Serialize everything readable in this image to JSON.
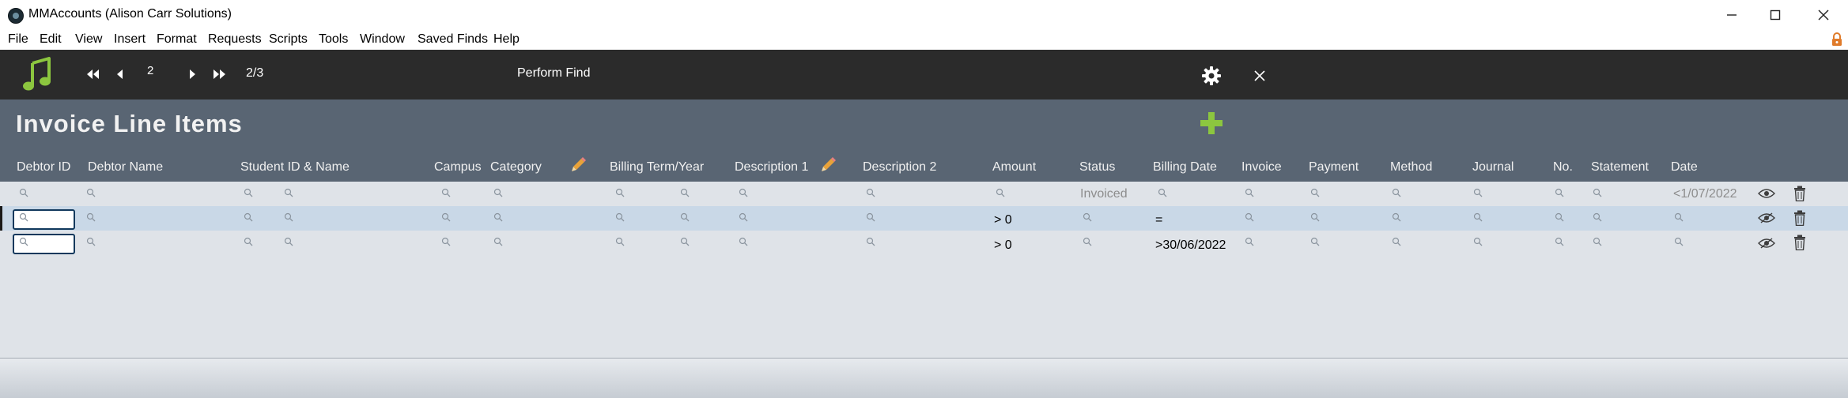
{
  "window": {
    "title": "MMAccounts (Alison Carr Solutions)",
    "minimize_icon": "minimize-icon",
    "maximize_icon": "maximize-icon",
    "close_icon": "close-icon"
  },
  "menu": {
    "items": [
      "File",
      "Edit",
      "View",
      "Insert",
      "Format",
      "Requests",
      "Scripts",
      "Tools",
      "Window",
      "Saved Finds",
      "Help"
    ]
  },
  "toolbar": {
    "record_number": "2",
    "record_count": "2/3",
    "perform_find": "Perform Find"
  },
  "header": {
    "title": "Invoice Line Items"
  },
  "columns": [
    "Debtor ID",
    "Debtor Name",
    "Student ID & Name",
    "Campus",
    "Category",
    "Billing Term/Year",
    "Description 1",
    "Description 2",
    "Amount",
    "Status",
    "Billing Date",
    "Invoice",
    "Payment",
    "Method",
    "Journal",
    "No.",
    "Statement",
    "Date"
  ],
  "rows": [
    {
      "status": "Invoiced",
      "date": "<1/07/2022",
      "amount": "",
      "billing_date": ""
    },
    {
      "status": "",
      "date": "",
      "amount": "> 0",
      "billing_date": "="
    },
    {
      "status": "",
      "date": "",
      "amount": "> 0",
      "billing_date": ">30/06/2022"
    }
  ],
  "colors": {
    "toolbar": "#2b2b2b",
    "header": "#596573",
    "accent_green": "#8cc63f",
    "body": "#dfe3e8",
    "selected_row": "#c9d8e7"
  }
}
